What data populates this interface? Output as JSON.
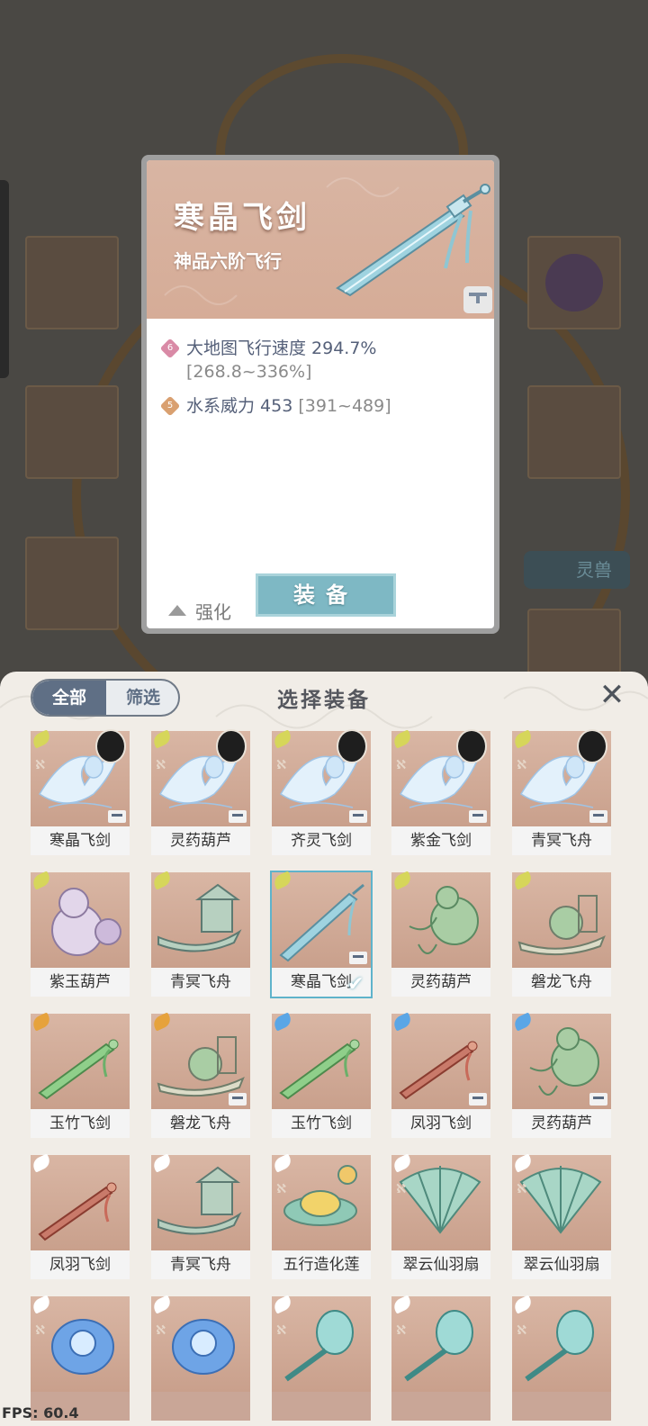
{
  "tooltip": {
    "title": "寒晶飞剑",
    "subtitle": "神品六阶飞行",
    "stats": [
      {
        "level": "6",
        "text": "大地图飞行速度 294.7%",
        "range": "[268.8~336%]",
        "gem_color": "#d98aa6"
      },
      {
        "level": "5",
        "text": "水系威力 453",
        "range": "[391~489]",
        "gem_color": "#d9a070"
      }
    ],
    "enhance_label": "强化",
    "equip_label": "装备"
  },
  "background": {
    "lingshou_label": "灵兽"
  },
  "panel": {
    "tabs": [
      "全部",
      "筛选"
    ],
    "title": "选择装备",
    "close_icon": "close-icon"
  },
  "items": [
    {
      "name": "寒晶飞剑",
      "art": "phoenix",
      "wing": "#d6d65a",
      "grade": "ℵ",
      "lock": true,
      "avatar": true,
      "selected": false
    },
    {
      "name": "灵药葫芦",
      "art": "phoenix",
      "wing": "#d6d65a",
      "grade": "ℵ",
      "lock": true,
      "avatar": true,
      "selected": false
    },
    {
      "name": "齐灵飞剑",
      "art": "phoenix",
      "wing": "#d6d65a",
      "grade": "ℵ",
      "lock": true,
      "avatar": true,
      "selected": false
    },
    {
      "name": "紫金飞剑",
      "art": "phoenix",
      "wing": "#d6d65a",
      "grade": "ℵ",
      "lock": true,
      "avatar": true,
      "selected": false
    },
    {
      "name": "青冥飞舟",
      "art": "phoenix",
      "wing": "#d6d65a",
      "grade": "ℵ",
      "lock": true,
      "avatar": true,
      "selected": false
    },
    {
      "name": "紫玉葫芦",
      "art": "gourd-purple",
      "wing": "#d6d65a",
      "grade": "",
      "lock": false,
      "avatar": false,
      "selected": false
    },
    {
      "name": "青冥飞舟",
      "art": "boat",
      "wing": "#d6d65a",
      "grade": "",
      "lock": false,
      "avatar": false,
      "selected": false
    },
    {
      "name": "寒晶飞剑",
      "art": "sword-blue",
      "wing": "#d6d65a",
      "grade": "",
      "lock": true,
      "avatar": false,
      "selected": true
    },
    {
      "name": "灵药葫芦",
      "art": "gourd-green",
      "wing": "#d6d65a",
      "grade": "",
      "lock": false,
      "avatar": false,
      "selected": false
    },
    {
      "name": "磐龙飞舟",
      "art": "dragon-boat",
      "wing": "#d6d65a",
      "grade": "",
      "lock": false,
      "avatar": false,
      "selected": false
    },
    {
      "name": "玉竹飞剑",
      "art": "sword-green",
      "wing": "#e6a23c",
      "grade": "",
      "lock": false,
      "avatar": false,
      "selected": false
    },
    {
      "name": "磐龙飞舟",
      "art": "dragon-boat",
      "wing": "#e6a23c",
      "grade": "",
      "lock": true,
      "avatar": false,
      "selected": false
    },
    {
      "name": "玉竹飞剑",
      "art": "sword-green",
      "wing": "#5aa6e6",
      "grade": "",
      "lock": false,
      "avatar": false,
      "selected": false
    },
    {
      "name": "凤羽飞剑",
      "art": "sword-red",
      "wing": "#5aa6e6",
      "grade": "",
      "lock": true,
      "avatar": false,
      "selected": false
    },
    {
      "name": "灵药葫芦",
      "art": "gourd-green",
      "wing": "#5aa6e6",
      "grade": "",
      "lock": true,
      "avatar": false,
      "selected": false
    },
    {
      "name": "凤羽飞剑",
      "art": "sword-red",
      "wing": "#ffffff",
      "grade": "",
      "lock": false,
      "avatar": false,
      "selected": false
    },
    {
      "name": "青冥飞舟",
      "art": "boat",
      "wing": "#ffffff",
      "grade": "",
      "lock": false,
      "avatar": false,
      "selected": false
    },
    {
      "name": "五行造化莲",
      "art": "lotus",
      "wing": "#ffffff",
      "grade": "ℵ",
      "lock": false,
      "avatar": false,
      "selected": false
    },
    {
      "name": "翠云仙羽扇",
      "art": "fan",
      "wing": "#ffffff",
      "grade": "ℵ",
      "lock": false,
      "avatar": false,
      "selected": false
    },
    {
      "name": "翠云仙羽扇",
      "art": "fan",
      "wing": "#ffffff",
      "grade": "ℵ",
      "lock": false,
      "avatar": false,
      "selected": false
    },
    {
      "name": "",
      "art": "orb-blue",
      "wing": "#ffffff",
      "grade": "ℵ",
      "lock": false,
      "avatar": false,
      "selected": false
    },
    {
      "name": "",
      "art": "orb-blue",
      "wing": "#ffffff",
      "grade": "ℵ",
      "lock": false,
      "avatar": false,
      "selected": false
    },
    {
      "name": "",
      "art": "mirror",
      "wing": "#ffffff",
      "grade": "ℵ",
      "lock": false,
      "avatar": false,
      "selected": false
    },
    {
      "name": "",
      "art": "mirror",
      "wing": "#ffffff",
      "grade": "ℵ",
      "lock": false,
      "avatar": false,
      "selected": false
    },
    {
      "name": "",
      "art": "mirror",
      "wing": "#ffffff",
      "grade": "ℵ",
      "lock": false,
      "avatar": false,
      "selected": false
    }
  ],
  "fps": "FPS: 60.4"
}
